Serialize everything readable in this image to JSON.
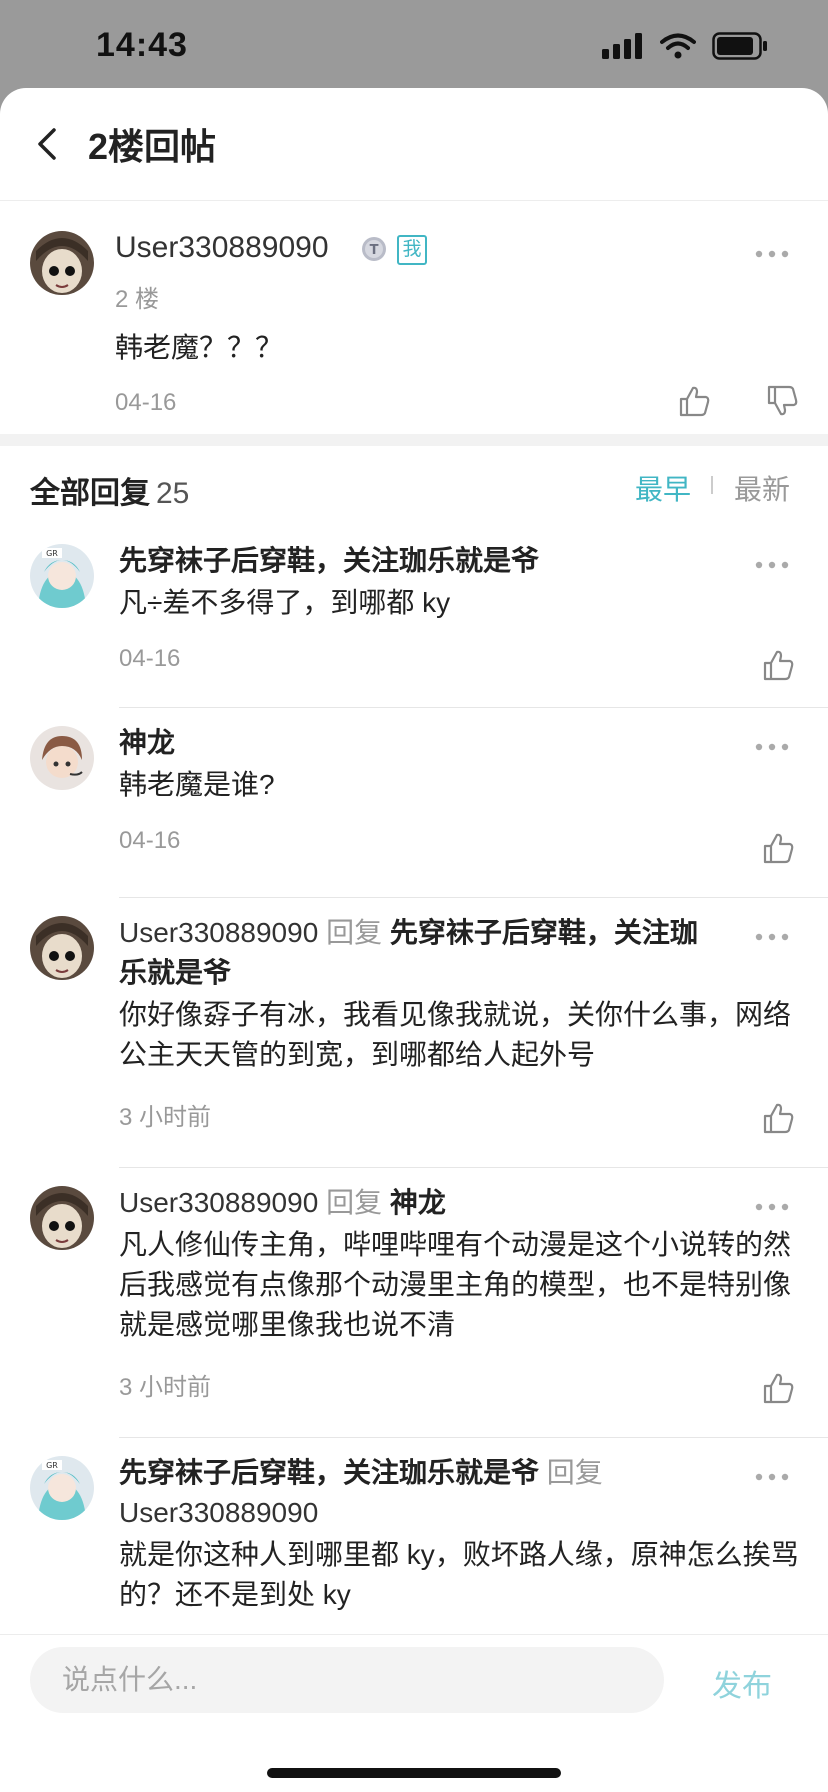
{
  "status_bar": {
    "time": "14:43"
  },
  "nav": {
    "title": "2楼回帖"
  },
  "post": {
    "username": "User330889090",
    "badge_me": "我",
    "floor": "2 楼",
    "content": "韩老魔？？？",
    "date": "04-16"
  },
  "replies_header": {
    "label": "全部回复",
    "count": "25",
    "sort_oldest": "最早",
    "sort_newest": "最新"
  },
  "replies": [
    {
      "author": "先穿袜子后穿鞋，关注珈乐就是爷",
      "reply_word": "",
      "reply_to": "",
      "content": "凡÷差不多得了，到哪都 ky",
      "time": "04-16"
    },
    {
      "author": "神龙",
      "reply_word": "",
      "reply_to": "",
      "content": "韩老魔是谁?",
      "time": "04-16"
    },
    {
      "author": "User330889090",
      "reply_word": "回复",
      "reply_to": "先穿袜子后穿鞋，关注珈乐就是爷",
      "content": "你好像孬子有冰，我看见像我就说，关你什么事，网络公主天天管的到宽，到哪都给人起外号",
      "time": "3 小时前"
    },
    {
      "author": "User330889090",
      "reply_word": "回复",
      "reply_to": "神龙",
      "content": "凡人修仙传主角，哔哩哔哩有个动漫是这个小说转的然后我感觉有点像那个动漫里主角的模型，也不是特别像就是感觉哪里像我也说不清",
      "time": "3 小时前"
    },
    {
      "author": "先穿袜子后穿鞋，关注珈乐就是爷",
      "reply_word": "回复",
      "reply_to": "User330889090",
      "content": "就是你这种人到哪里都 ky，败坏路人缘，原神怎么挨骂的？还不是到处 ky",
      "time": ""
    }
  ],
  "bottom_bar": {
    "placeholder": "说点什么...",
    "publish_label": "发布"
  },
  "colors": {
    "accent": "#41b6c4",
    "publish_disabled": "#8fd3dc",
    "muted_text": "#999999"
  }
}
